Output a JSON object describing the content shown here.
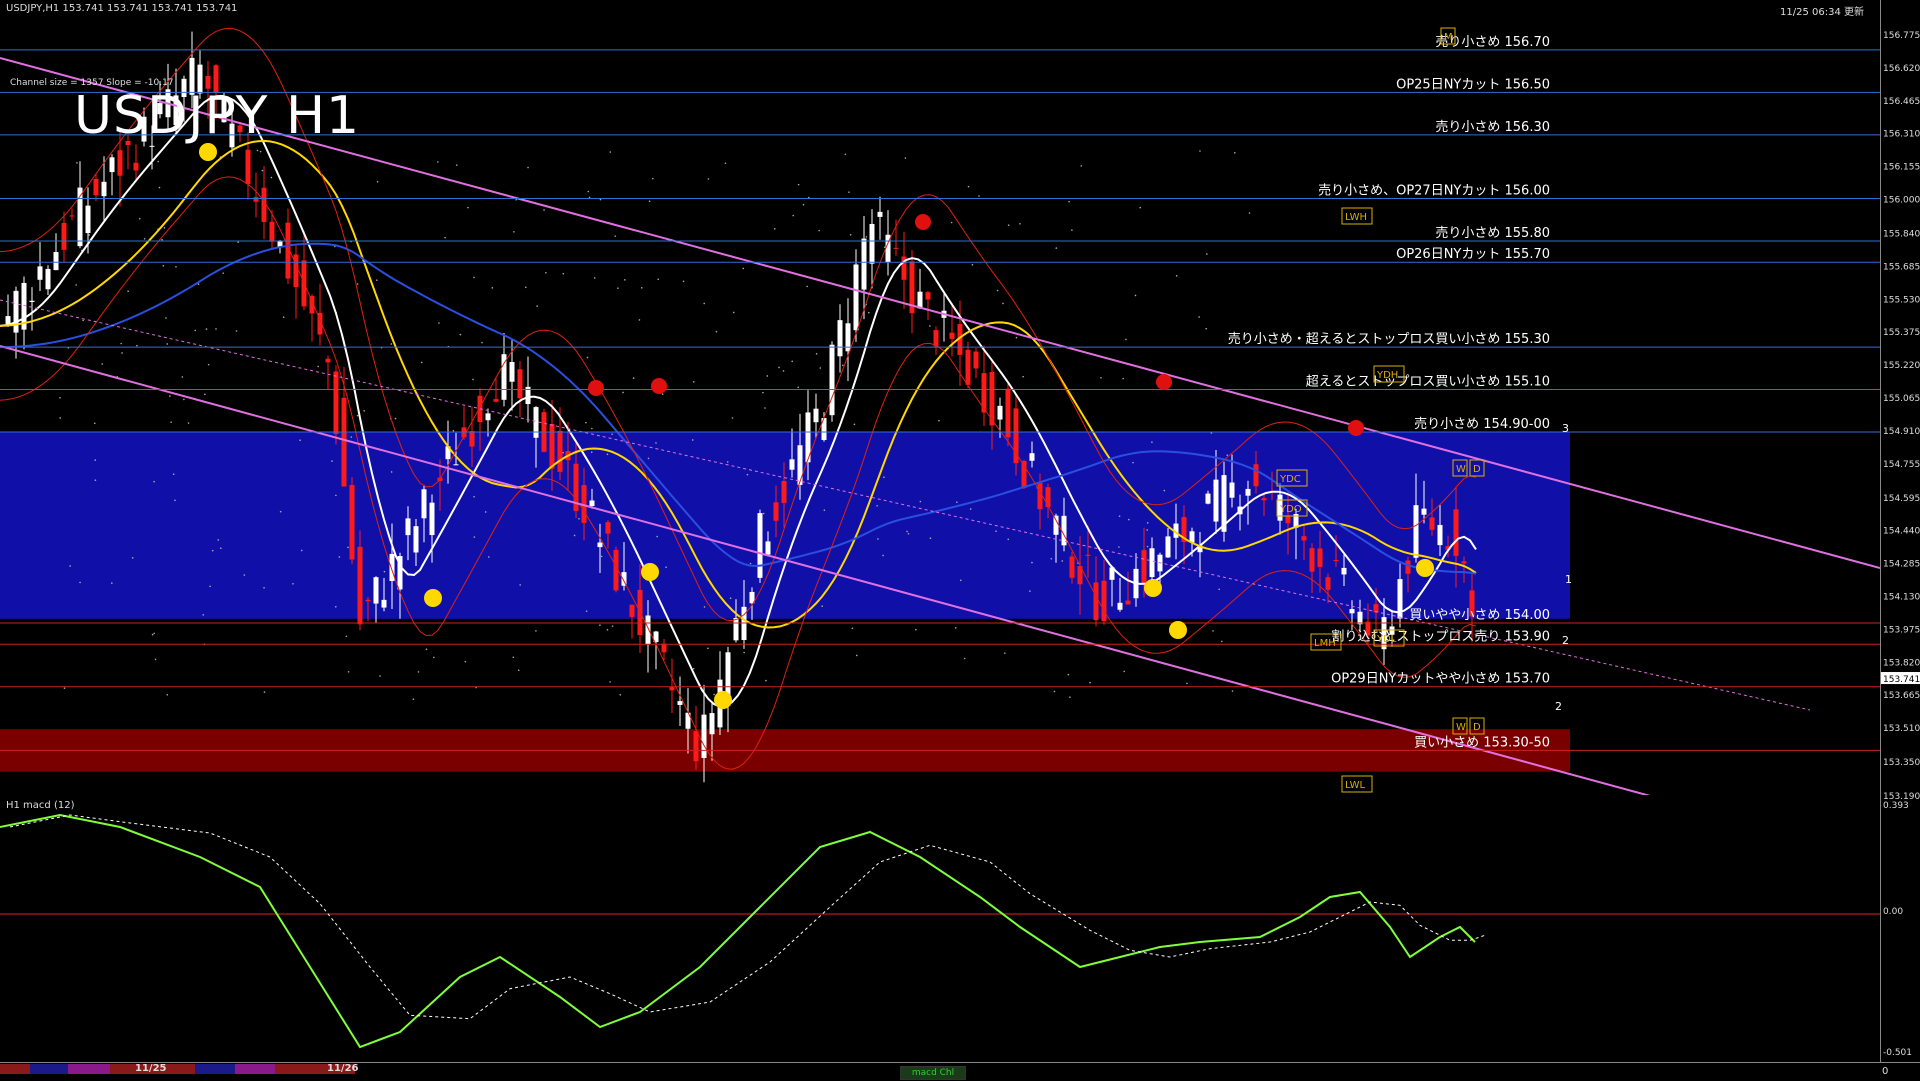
{
  "header": {
    "symbol_info": "USDJPY,H1  153.741 153.741 153.741 153.741",
    "time": "11/25 06:34 更新",
    "channel_info": "Channel size = 1357 Slope = -10.17",
    "big_title": "USDJPY H1"
  },
  "levels": [
    {
      "price": 156.7,
      "label": "売り小さめ 156.70",
      "line": "#2f6fd6"
    },
    {
      "price": 156.5,
      "label": "OP25日NYカット 156.50",
      "line": "#2f6fd6"
    },
    {
      "price": 156.3,
      "label": "売り小さめ 156.30",
      "line": "#2f6fd6"
    },
    {
      "price": 156.0,
      "label": "売り小さめ、OP27日NYカット 156.00",
      "line": "#2f6fd6"
    },
    {
      "price": 155.8,
      "label": "売り小さめ 155.80",
      "line": "#2f6fd6"
    },
    {
      "price": 155.7,
      "label": "OP26日NYカット 155.70",
      "line": "#2f6fd6"
    },
    {
      "price": 155.3,
      "label": "売り小さめ・超えるとストップロス買い小さめ 155.30",
      "line": "#2f6fd6"
    },
    {
      "price": 155.1,
      "label": "超えるとストップロス買い小さめ 155.10",
      "line": "#2f6fd6"
    },
    {
      "price": 154.9,
      "label": "売り小さめ 154.90-00",
      "line": "#2f6fd6"
    },
    {
      "price": 154.0,
      "label": "買いやや小さめ 154.00",
      "line": "#cc2222"
    },
    {
      "price": 153.9,
      "label": "割り込むとストップロス売り 153.90",
      "line": "#cc2222"
    },
    {
      "price": 153.7,
      "label": "OP29日NYカットやや小さめ 153.70",
      "line": "#cc2222"
    },
    {
      "price": 153.4,
      "label": "買い小さめ 153.30-50",
      "line": "#cc2222"
    }
  ],
  "price_axis": [
    "156.775",
    "156.620",
    "156.465",
    "156.310",
    "156.155",
    "156.000",
    "155.840",
    "155.685",
    "155.530",
    "155.375",
    "155.220",
    "155.065",
    "154.910",
    "154.755",
    "154.595",
    "154.440",
    "154.285",
    "154.130",
    "153.975",
    "153.820",
    "153.665",
    "153.510",
    "153.350",
    "153.190"
  ],
  "current_price": "153.741",
  "zones": {
    "blue": [
      154.9,
      154.02
    ],
    "red": [
      153.5,
      153.3
    ],
    "color_blue": "#1010a8",
    "color_red": "#7a0000"
  },
  "boxes": [
    "LWH",
    "YDH",
    "YDC",
    "YDO",
    "LMH",
    "YDL",
    "LWL",
    "W",
    "D",
    "W",
    "D",
    "M"
  ],
  "wave_marks": [
    "3",
    "2",
    "1",
    "2"
  ],
  "macd": {
    "title": "H1  macd (12)",
    "axis": [
      "0.393",
      "0.00",
      "-0.501"
    ],
    "tab_label": "macd Chl"
  },
  "dates": [
    "11/25",
    "11/26"
  ],
  "bottom_axis": "0"
}
